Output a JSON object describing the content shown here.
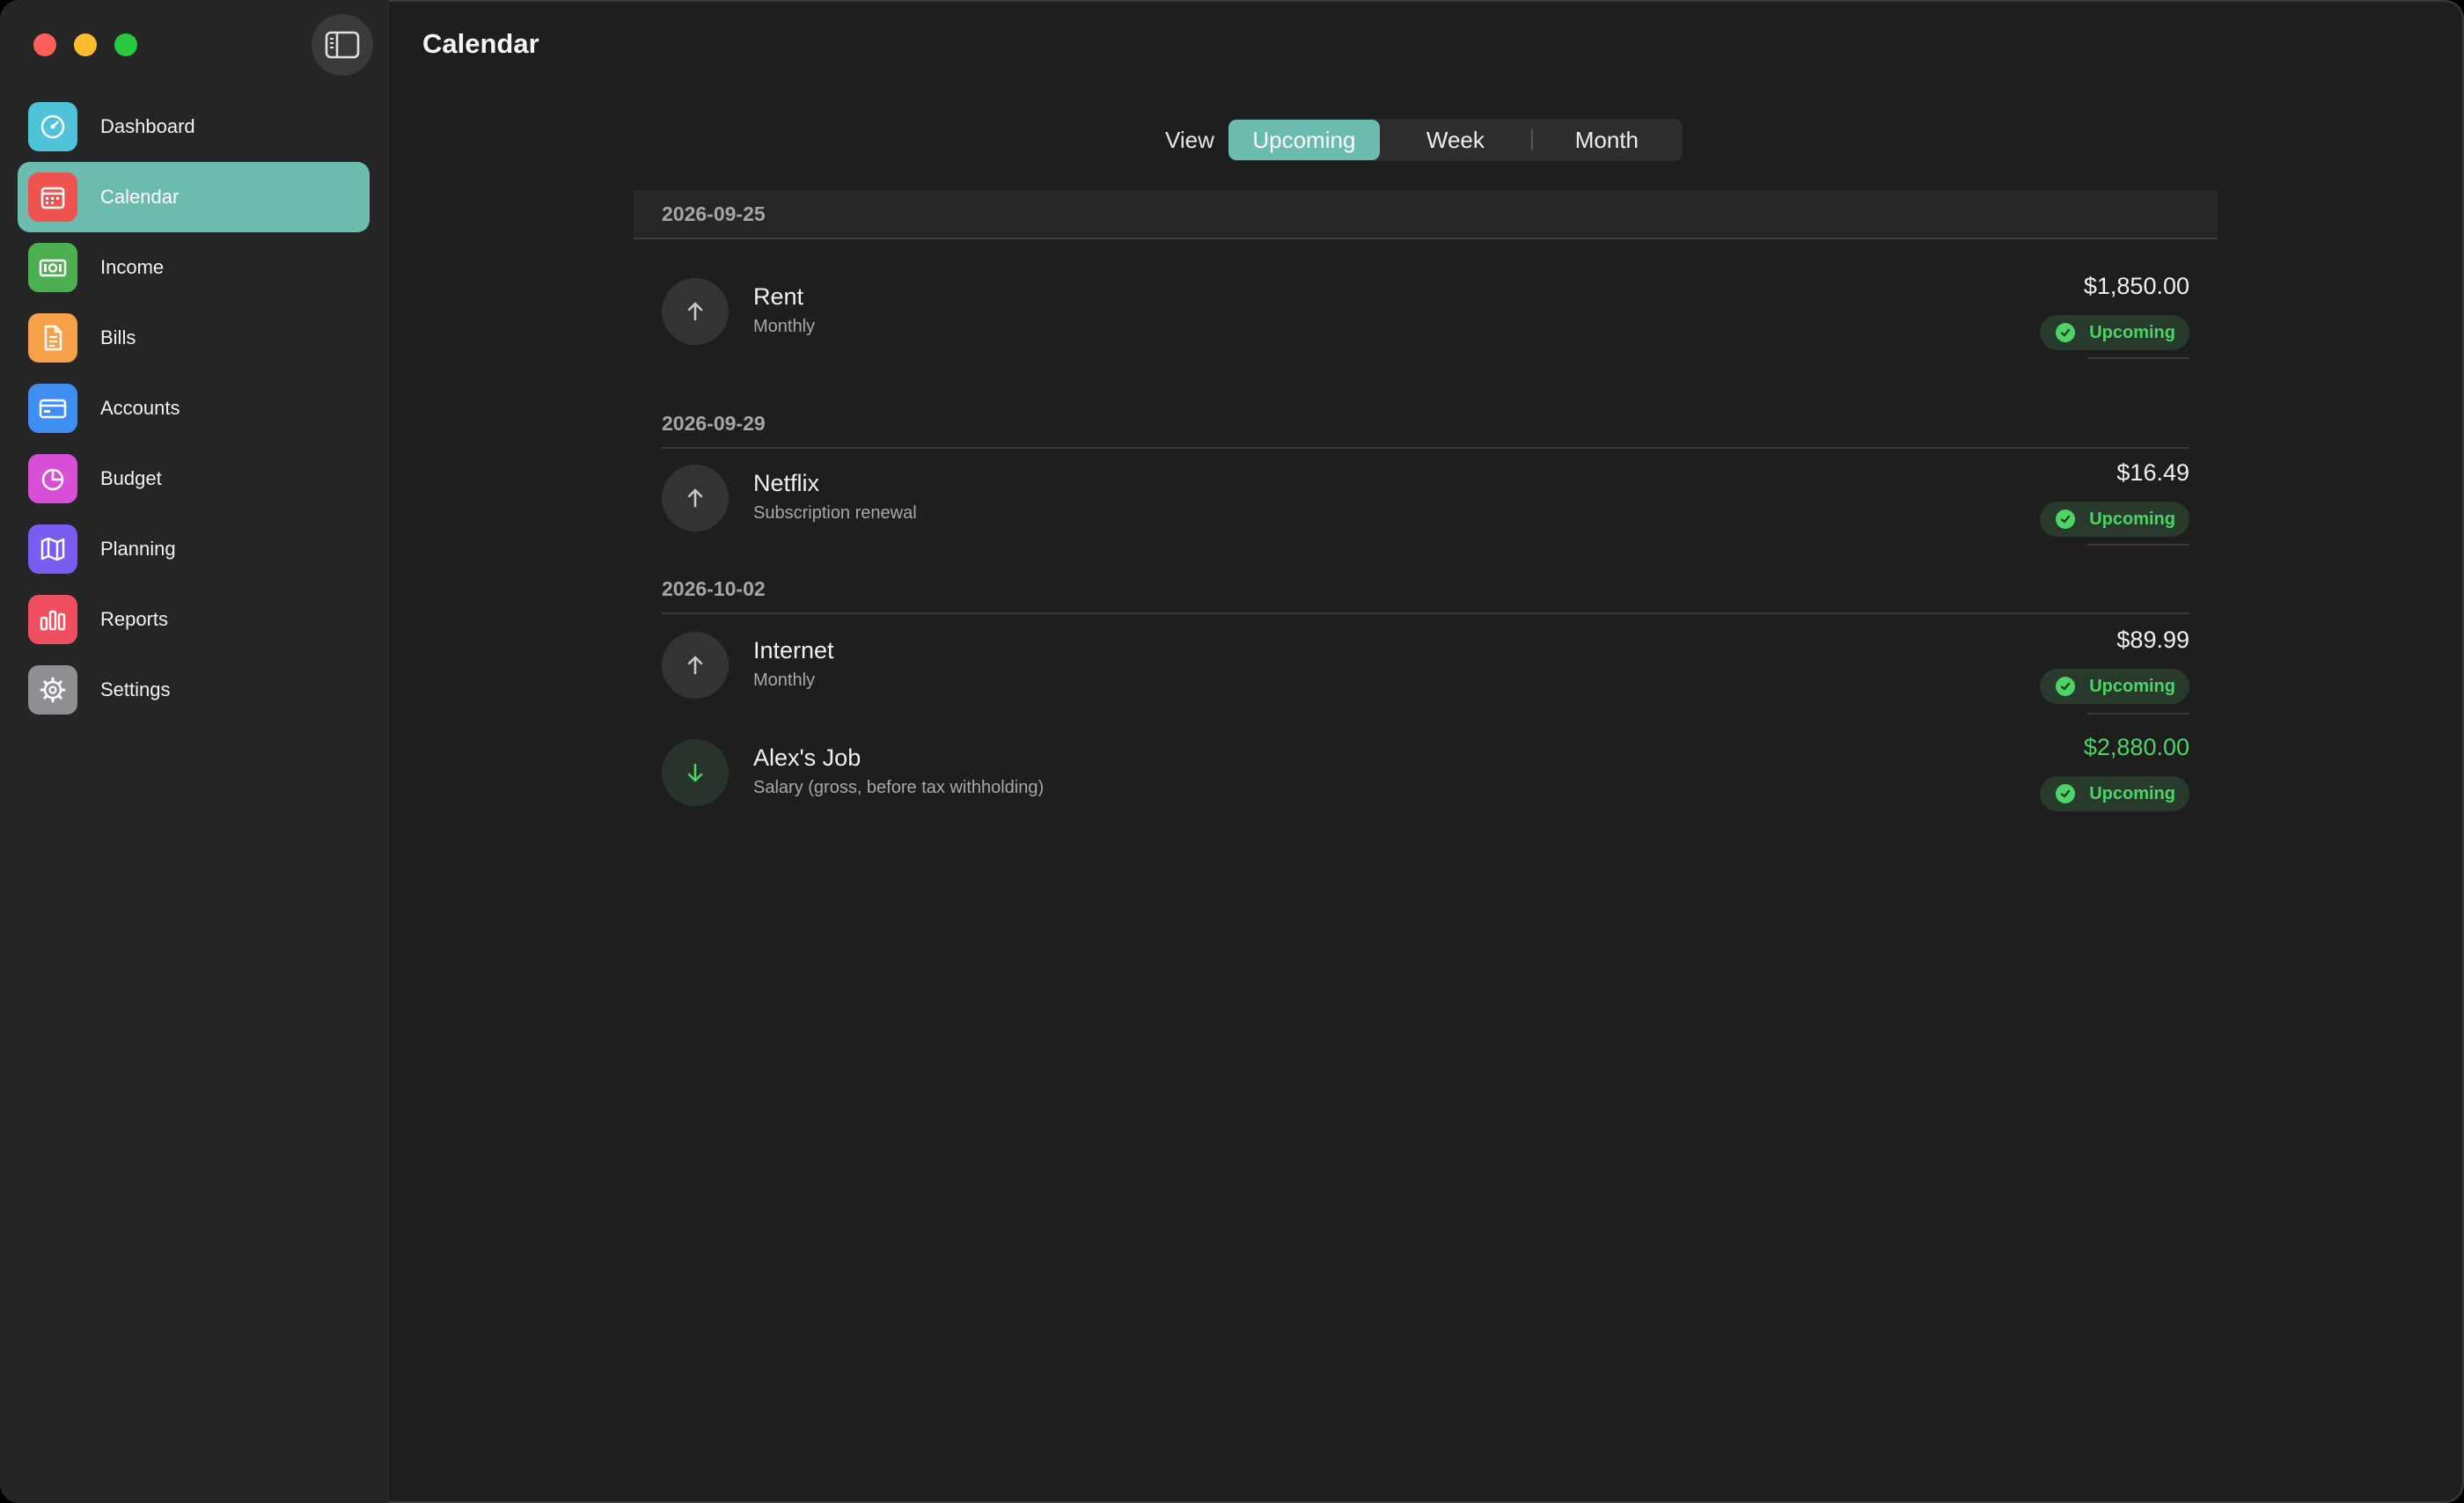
{
  "window": {
    "title": "Calendar"
  },
  "sidebar": {
    "items": [
      {
        "label": "Dashboard",
        "icon": "dashboard-gauge-icon",
        "color": "#4fc3d9"
      },
      {
        "label": "Calendar",
        "icon": "calendar-icon",
        "color": "#ef5350",
        "active": true
      },
      {
        "label": "Income",
        "icon": "banknote-icon",
        "color": "#4caf50"
      },
      {
        "label": "Bills",
        "icon": "document-icon",
        "color": "#f7a04a"
      },
      {
        "label": "Accounts",
        "icon": "credit-card-icon",
        "color": "#3f8ff2"
      },
      {
        "label": "Budget",
        "icon": "pie-chart-icon",
        "color": "#d64fd6"
      },
      {
        "label": "Planning",
        "icon": "map-icon",
        "color": "#7b5cf0"
      },
      {
        "label": "Reports",
        "icon": "bar-chart-icon",
        "color": "#ef4f5f"
      },
      {
        "label": "Settings",
        "icon": "gear-icon",
        "color": "#8e8e93"
      }
    ]
  },
  "view": {
    "label": "View",
    "options": [
      "Upcoming",
      "Week",
      "Month"
    ],
    "selected": "Upcoming"
  },
  "groups": [
    {
      "date": "2026-09-25",
      "items": [
        {
          "name": "Rent",
          "sub": "Monthly",
          "amount": "$1,850.00",
          "status": "Upcoming",
          "direction": "out"
        }
      ]
    },
    {
      "date": "2026-09-29",
      "items": [
        {
          "name": "Netflix",
          "sub": "Subscription renewal",
          "amount": "$16.49",
          "status": "Upcoming",
          "direction": "out"
        }
      ]
    },
    {
      "date": "2026-10-02",
      "items": [
        {
          "name": "Internet",
          "sub": "Monthly",
          "amount": "$89.99",
          "status": "Upcoming",
          "direction": "out"
        },
        {
          "name": "Alex's Job",
          "sub": "Salary (gross, before tax withholding)",
          "amount": "$2,880.00",
          "status": "Upcoming",
          "direction": "in"
        }
      ]
    }
  ],
  "colors": {
    "accent": "#6bbcae",
    "success": "#4cd467"
  }
}
